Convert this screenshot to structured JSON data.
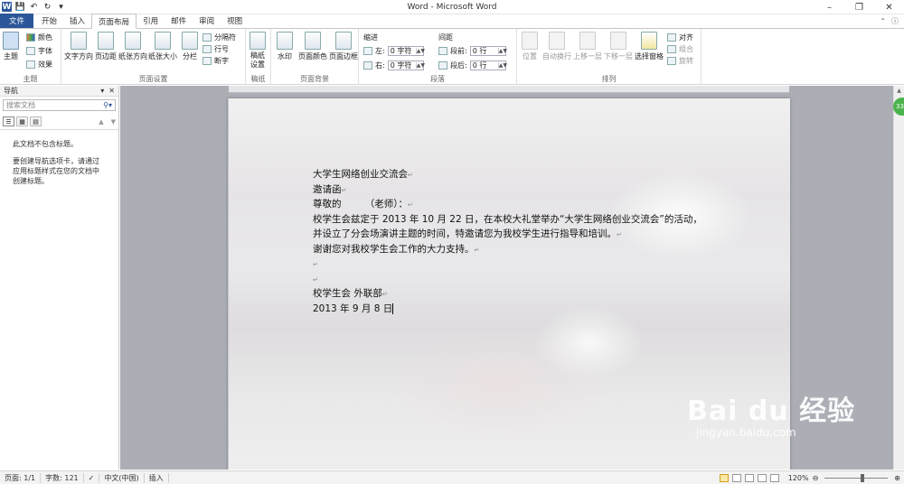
{
  "window": {
    "title": "Word - Microsoft Word"
  },
  "tabs": [
    "文件",
    "开始",
    "插入",
    "页面布局",
    "引用",
    "邮件",
    "审阅",
    "视图"
  ],
  "active_tab": "页面布局",
  "ribbon": {
    "theme": {
      "label": "主题",
      "btn": "主题",
      "colors": "颜色",
      "fonts": "字体",
      "effects": "效果"
    },
    "page_setup": {
      "label": "页面设置",
      "text_dir": "文字方向",
      "margins": "页边距",
      "orientation": "纸张方向",
      "size": "纸张大小",
      "columns": "分栏",
      "breaks": "分隔符",
      "line_numbers": "行号",
      "hyphenation": "断字"
    },
    "draft": {
      "label": "稿纸",
      "btn": "稿纸\n设置"
    },
    "page_bg": {
      "label": "页面背景",
      "watermark": "水印",
      "page_color": "页面颜色",
      "page_border": "页面边框"
    },
    "paragraph": {
      "label": "段落",
      "indent": "缩进",
      "spacing": "间距",
      "left": "左:",
      "right": "右:",
      "before": "段前:",
      "after": "段后:",
      "left_val": "0 字符",
      "right_val": "0 字符",
      "before_val": "0 行",
      "after_val": "0 行"
    },
    "arrange": {
      "label": "排列",
      "position": "位置",
      "wrap": "自动换行",
      "forward": "上移一层",
      "backward": "下移一层",
      "selection_pane": "选择窗格",
      "align": "对齐",
      "group": "组合",
      "rotate": "旋转"
    }
  },
  "nav": {
    "title": "导航",
    "search_placeholder": "搜索文档",
    "msg1": "此文档不包含标题。",
    "msg2": "要创建导航选项卡，请通过应用标题样式在您的文档中创建标题。"
  },
  "document": {
    "lines": [
      "大学生网络创业交流会",
      "邀请函",
      "尊敬的　　　（老师）：",
      "校学生会兹定于 2013 年 10 月 22 日，在本校大礼堂举办“大学生网络创业交流会”的活动，",
      "并设立了分会场演讲主题的时间，特邀请您为我校学生进行指导和培训。",
      "谢谢您对我校学生会工作的大力支持。",
      "",
      "",
      "校学生会 外联部",
      "2013 年 9 月 8 日"
    ]
  },
  "badge": "33",
  "watermark": {
    "logo": "Bai du 经验",
    "sub": "jingyan.baidu.com"
  },
  "status": {
    "page": "页面: 1/1",
    "words": "字数: 121",
    "lang": "中文(中国)",
    "mode": "插入",
    "zoom": "120%"
  }
}
